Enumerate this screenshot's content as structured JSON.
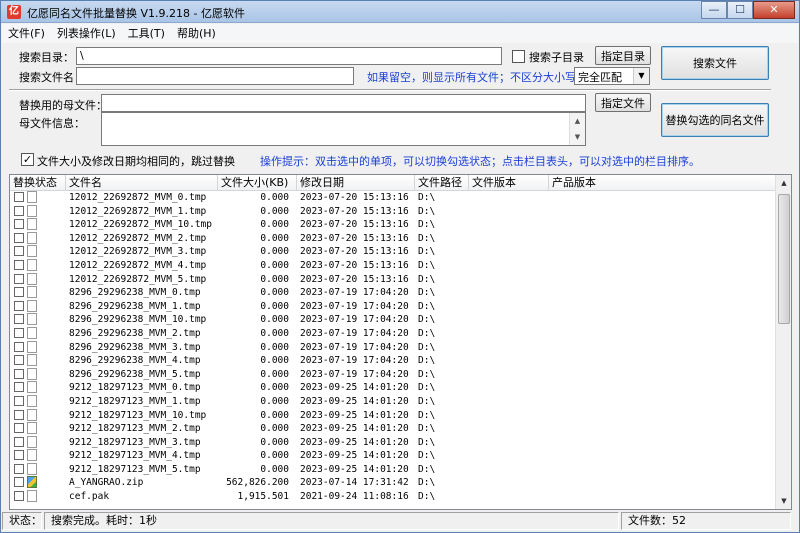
{
  "window": {
    "title": "亿愿同名文件批量替换 V1.9.218 - 亿愿软件"
  },
  "title_buttons": {
    "minimize": "—",
    "maximize": "☐",
    "close": "✕"
  },
  "menu": [
    {
      "label": "文件(F)"
    },
    {
      "label": "列表操作(L)"
    },
    {
      "label": "工具(T)"
    },
    {
      "label": "帮助(H)"
    }
  ],
  "search": {
    "dir_label": "搜索目录：",
    "dir_value": "\\",
    "subdir_checked": false,
    "subdir_label": "搜索子目录",
    "choose_dir_button": "指定目录",
    "filename_label": "搜索文件名：",
    "filename_value": "",
    "hint": "如果留空，则显示所有文件；不区分大小写",
    "match_mode": "完全匹配",
    "search_button": "搜索文件"
  },
  "replace": {
    "source_label": "替换用的母文件：",
    "source_value": "",
    "choose_file_button": "指定文件",
    "info_label": "母文件信息：",
    "replace_button": "替换勾选的同名文件",
    "skip_same_checked": true,
    "skip_same_label": "文件大小及修改日期均相同的，跳过替换",
    "tip": "操作提示：双击选中的单项，可以切换勾选状态；点击栏目表头，可以对选中的栏目排序。"
  },
  "table": {
    "columns": [
      "替换状态",
      "文件名",
      "文件大小(KB)",
      "修改日期",
      "文件路径",
      "文件版本",
      "产品版本"
    ],
    "rows": [
      {
        "name": "12012_22692872_MVM_0.tmp",
        "size": "0.000",
        "date": "2023-07-20 15:13:16",
        "path": "D:\\",
        "icon": "file"
      },
      {
        "name": "12012_22692872_MVM_1.tmp",
        "size": "0.000",
        "date": "2023-07-20 15:13:16",
        "path": "D:\\",
        "icon": "file"
      },
      {
        "name": "12012_22692872_MVM_10.tmp",
        "size": "0.000",
        "date": "2023-07-20 15:13:16",
        "path": "D:\\",
        "icon": "file"
      },
      {
        "name": "12012_22692872_MVM_2.tmp",
        "size": "0.000",
        "date": "2023-07-20 15:13:16",
        "path": "D:\\",
        "icon": "file"
      },
      {
        "name": "12012_22692872_MVM_3.tmp",
        "size": "0.000",
        "date": "2023-07-20 15:13:16",
        "path": "D:\\",
        "icon": "file"
      },
      {
        "name": "12012_22692872_MVM_4.tmp",
        "size": "0.000",
        "date": "2023-07-20 15:13:16",
        "path": "D:\\",
        "icon": "file"
      },
      {
        "name": "12012_22692872_MVM_5.tmp",
        "size": "0.000",
        "date": "2023-07-20 15:13:16",
        "path": "D:\\",
        "icon": "file"
      },
      {
        "name": "8296_29296238_MVM_0.tmp",
        "size": "0.000",
        "date": "2023-07-19 17:04:20",
        "path": "D:\\",
        "icon": "file"
      },
      {
        "name": "8296_29296238_MVM_1.tmp",
        "size": "0.000",
        "date": "2023-07-19 17:04:20",
        "path": "D:\\",
        "icon": "file"
      },
      {
        "name": "8296_29296238_MVM_10.tmp",
        "size": "0.000",
        "date": "2023-07-19 17:04:20",
        "path": "D:\\",
        "icon": "file"
      },
      {
        "name": "8296_29296238_MVM_2.tmp",
        "size": "0.000",
        "date": "2023-07-19 17:04:20",
        "path": "D:\\",
        "icon": "file"
      },
      {
        "name": "8296_29296238_MVM_3.tmp",
        "size": "0.000",
        "date": "2023-07-19 17:04:20",
        "path": "D:\\",
        "icon": "file"
      },
      {
        "name": "8296_29296238_MVM_4.tmp",
        "size": "0.000",
        "date": "2023-07-19 17:04:20",
        "path": "D:\\",
        "icon": "file"
      },
      {
        "name": "8296_29296238_MVM_5.tmp",
        "size": "0.000",
        "date": "2023-07-19 17:04:20",
        "path": "D:\\",
        "icon": "file"
      },
      {
        "name": "9212_18297123_MVM_0.tmp",
        "size": "0.000",
        "date": "2023-09-25 14:01:20",
        "path": "D:\\",
        "icon": "file"
      },
      {
        "name": "9212_18297123_MVM_1.tmp",
        "size": "0.000",
        "date": "2023-09-25 14:01:20",
        "path": "D:\\",
        "icon": "file"
      },
      {
        "name": "9212_18297123_MVM_10.tmp",
        "size": "0.000",
        "date": "2023-09-25 14:01:20",
        "path": "D:\\",
        "icon": "file"
      },
      {
        "name": "9212_18297123_MVM_2.tmp",
        "size": "0.000",
        "date": "2023-09-25 14:01:20",
        "path": "D:\\",
        "icon": "file"
      },
      {
        "name": "9212_18297123_MVM_3.tmp",
        "size": "0.000",
        "date": "2023-09-25 14:01:20",
        "path": "D:\\",
        "icon": "file"
      },
      {
        "name": "9212_18297123_MVM_4.tmp",
        "size": "0.000",
        "date": "2023-09-25 14:01:20",
        "path": "D:\\",
        "icon": "file"
      },
      {
        "name": "9212_18297123_MVM_5.tmp",
        "size": "0.000",
        "date": "2023-09-25 14:01:20",
        "path": "D:\\",
        "icon": "file"
      },
      {
        "name": "A_YANGRAO.zip",
        "size": "562,826.200",
        "date": "2023-07-14 17:31:42",
        "path": "D:\\",
        "icon": "zip"
      },
      {
        "name": "cef.pak",
        "size": "1,915.501",
        "date": "2021-09-24 11:08:16",
        "path": "D:\\",
        "icon": "file"
      }
    ]
  },
  "status": {
    "label": "状态：",
    "message": "搜索完成。耗时：1秒",
    "file_count": "文件数：52"
  }
}
